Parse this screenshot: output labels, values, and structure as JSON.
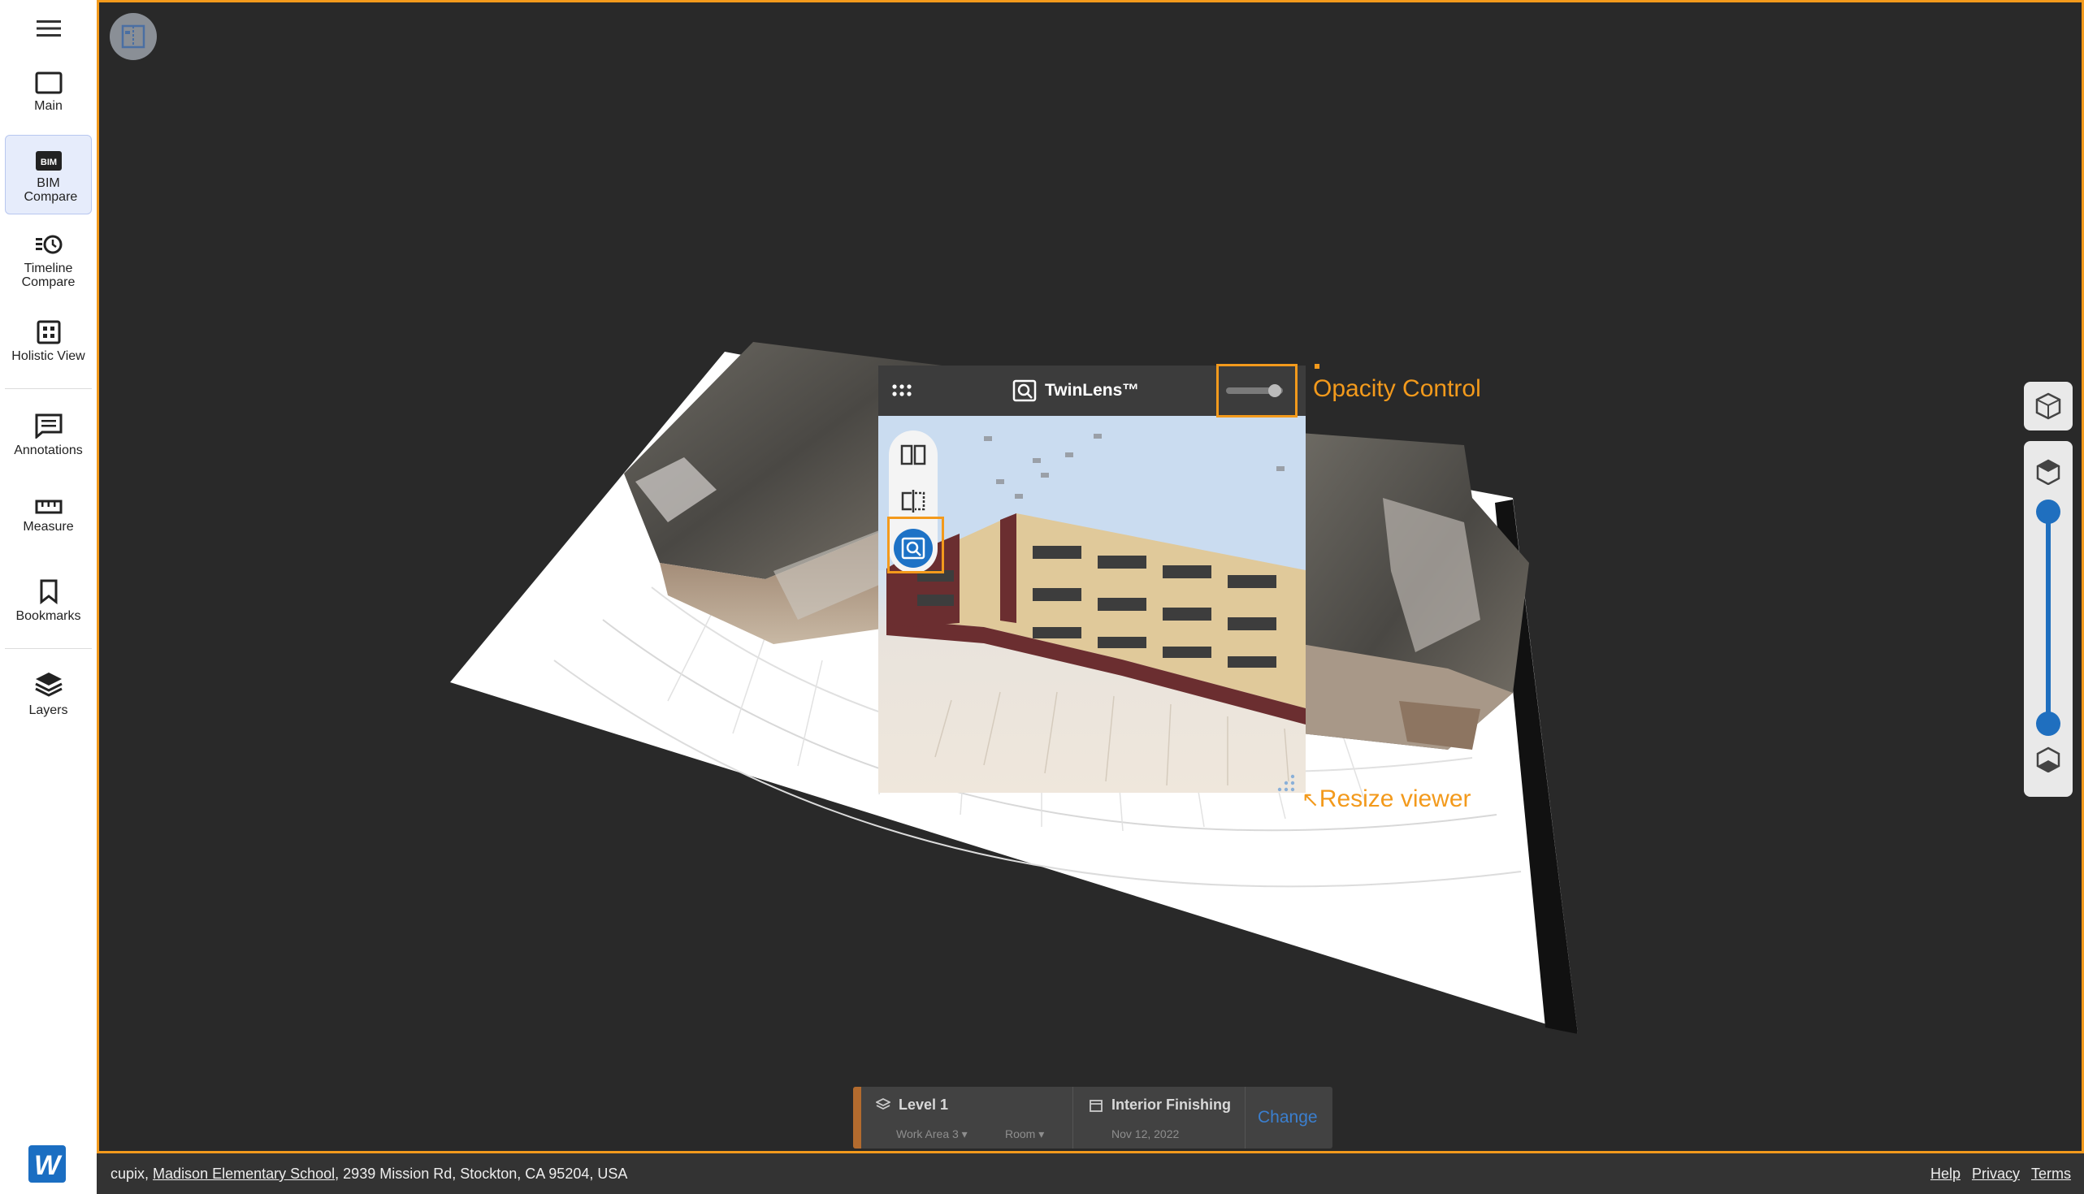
{
  "sidebar": {
    "items": [
      {
        "label": "Main",
        "icon": "rectangle-icon"
      },
      {
        "label": "BIM Compare",
        "icon": "bim-icon",
        "active": true
      },
      {
        "label": "Timeline Compare",
        "icon": "timeline-icon"
      },
      {
        "label": "Holistic View",
        "icon": "grid-icon"
      },
      {
        "label": "Annotations",
        "icon": "annotation-icon"
      },
      {
        "label": "Measure",
        "icon": "ruler-icon"
      },
      {
        "label": "Bookmarks",
        "icon": "bookmark-icon"
      },
      {
        "label": "Layers",
        "icon": "layers-icon"
      }
    ],
    "bim_badge": "BIM",
    "logo_letter": "W"
  },
  "twinlens": {
    "title": "TwinLens™",
    "opacity": 0.85
  },
  "callouts": {
    "opacity": "Opacity Control",
    "resize": "Resize viewer"
  },
  "bottom_panel": {
    "level": "Level 1",
    "work_area": "Work Area 3",
    "room": "Room",
    "phase": "Interior Finishing",
    "date": "Nov 12, 2022",
    "change": "Change"
  },
  "statusbar": {
    "org": "cupix,",
    "project": "Madison Elementary School",
    "address": ", 2939 Mission Rd, Stockton, CA 95204, USA",
    "links": [
      "Help",
      "Privacy",
      "Terms"
    ]
  },
  "colors": {
    "accent": "#f39a1c",
    "primary": "#1d72c6",
    "viewport_bg": "#292929"
  }
}
